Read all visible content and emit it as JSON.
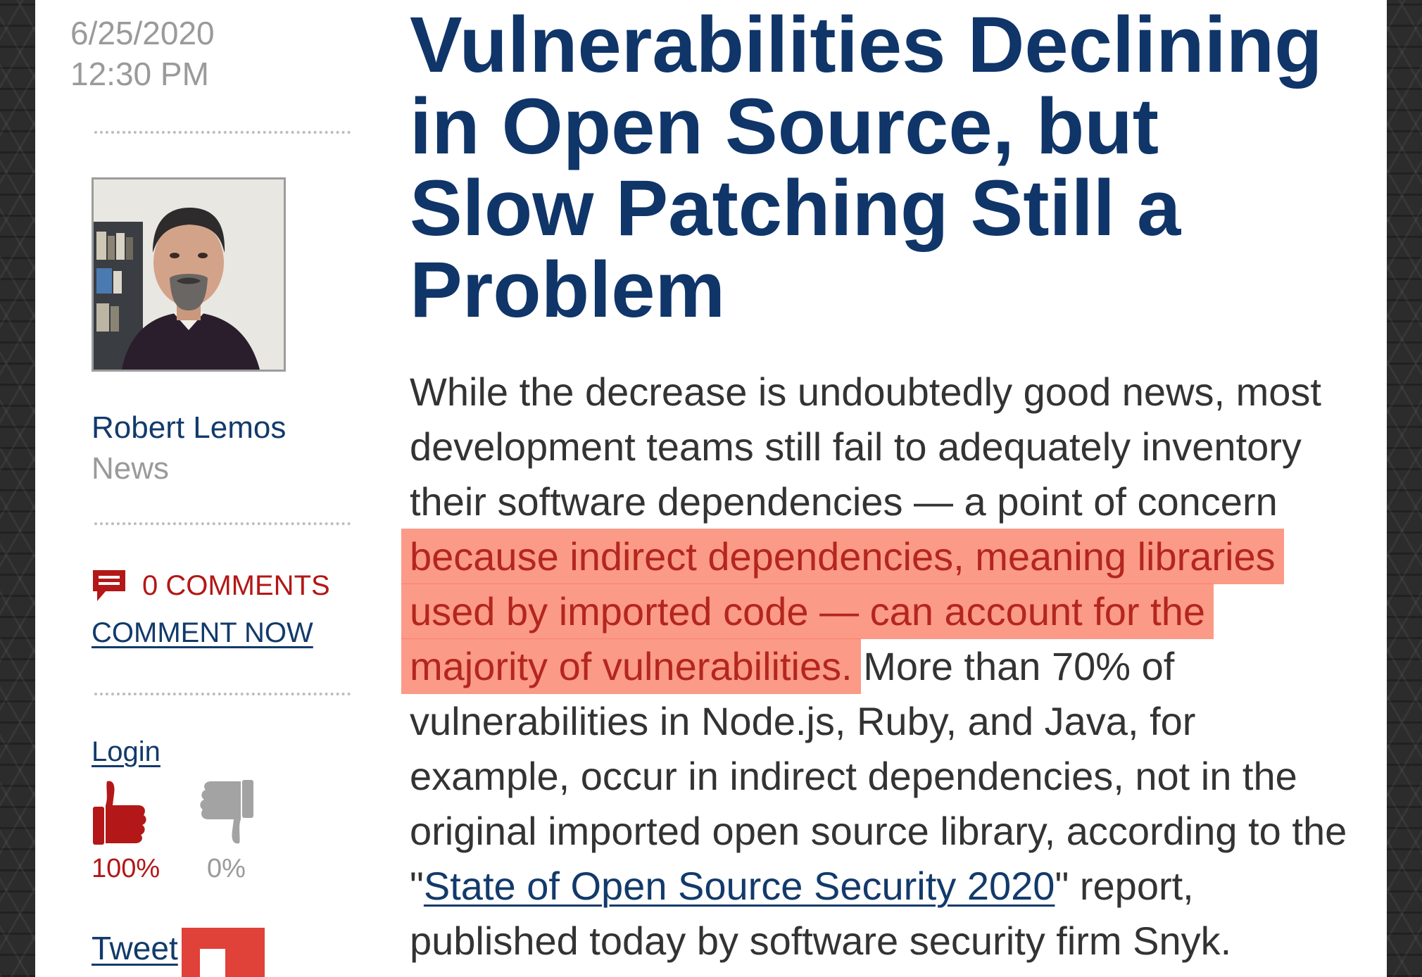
{
  "article": {
    "date": "6/25/2020",
    "time": "12:30 PM",
    "title": "Vulnerabilities Declining in Open Source, but Slow Patching Still a Problem",
    "body_before_highlight": "While the decrease is undoubtedly good news, most development teams still fail to adequately inventory their software dependencies — a point of concern ",
    "highlighted_text": "because indirect dependencies, meaning libraries used by imported code — can account for the majority of vulnerabilities.",
    "body_after_highlight": " More than 70% of vulnerabilities in Node.js, Ruby, and Java, for example, occur in indirect dependencies, not in the original imported open source library, according to the \"",
    "report_link_text": "State of Open Source Security 2020",
    "body_end": "\" report, published today by software security firm Snyk."
  },
  "author": {
    "name": "Robert Lemos",
    "section": "News"
  },
  "comments": {
    "count_label": "0 COMMENTS",
    "comment_now_label": "COMMENT NOW"
  },
  "voting": {
    "login_label": "Login",
    "up_percent": "100%",
    "down_percent": "0%"
  },
  "share": {
    "tweet_label": "Tweet"
  },
  "icons": {
    "comment": "comment-bubble-icon",
    "thumbs_up": "thumbs-up-icon",
    "thumbs_down": "thumbs-down-icon",
    "flipboard": "flipboard-icon"
  },
  "colors": {
    "title": "#0f3569",
    "link": "#123a6b",
    "accent_red": "#b31717",
    "highlight": "#fa785f",
    "muted": "#9a9a9a"
  }
}
